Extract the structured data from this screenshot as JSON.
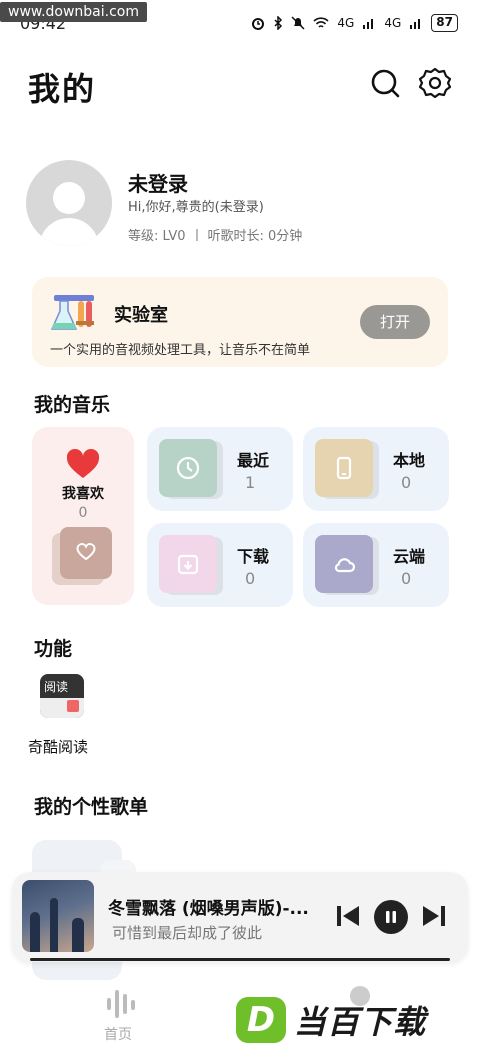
{
  "status_bar": {
    "watermark": "www.downbai.com",
    "time": "09:42",
    "network": "4G",
    "network2": "4G",
    "battery": "87"
  },
  "header": {
    "title": "我的"
  },
  "profile": {
    "name": "未登录",
    "greeting": "Hi,你好,尊贵的(未登录)",
    "level": "等级: LV0",
    "listen_time": "听歌时长: 0分钟"
  },
  "lab": {
    "title": "实验室",
    "description": "一个实用的音视频处理工具，让音乐不在简单",
    "open_label": "打开"
  },
  "my_music": {
    "title": "我的音乐",
    "favorites": {
      "label": "我喜欢",
      "count": "0"
    },
    "recent": {
      "label": "最近",
      "count": "1"
    },
    "local": {
      "label": "本地",
      "count": "0"
    },
    "downloads": {
      "label": "下载",
      "count": "0"
    },
    "cloud": {
      "label": "云端",
      "count": "0"
    }
  },
  "functions": {
    "title": "功能",
    "items": [
      {
        "label": "奇酷阅读",
        "icon_text": "阅读"
      }
    ]
  },
  "playlists": {
    "title": "我的个性歌单"
  },
  "player": {
    "song_title": "冬雪飘落 (烟嗓男声版)-...",
    "song_subtitle": "可惜到最后却成了彼此",
    "progress": 1.0
  },
  "bottom_nav": {
    "home_label": "首页"
  },
  "brand": {
    "letter": "D",
    "text": "当百下载"
  },
  "colors": {
    "lab_bg": "#fdf5ea",
    "fav_bg": "#fdeeee",
    "tile_bg": "#edf3fa",
    "heart": "#e83a3a",
    "brand_green": "#6fbf2a"
  }
}
